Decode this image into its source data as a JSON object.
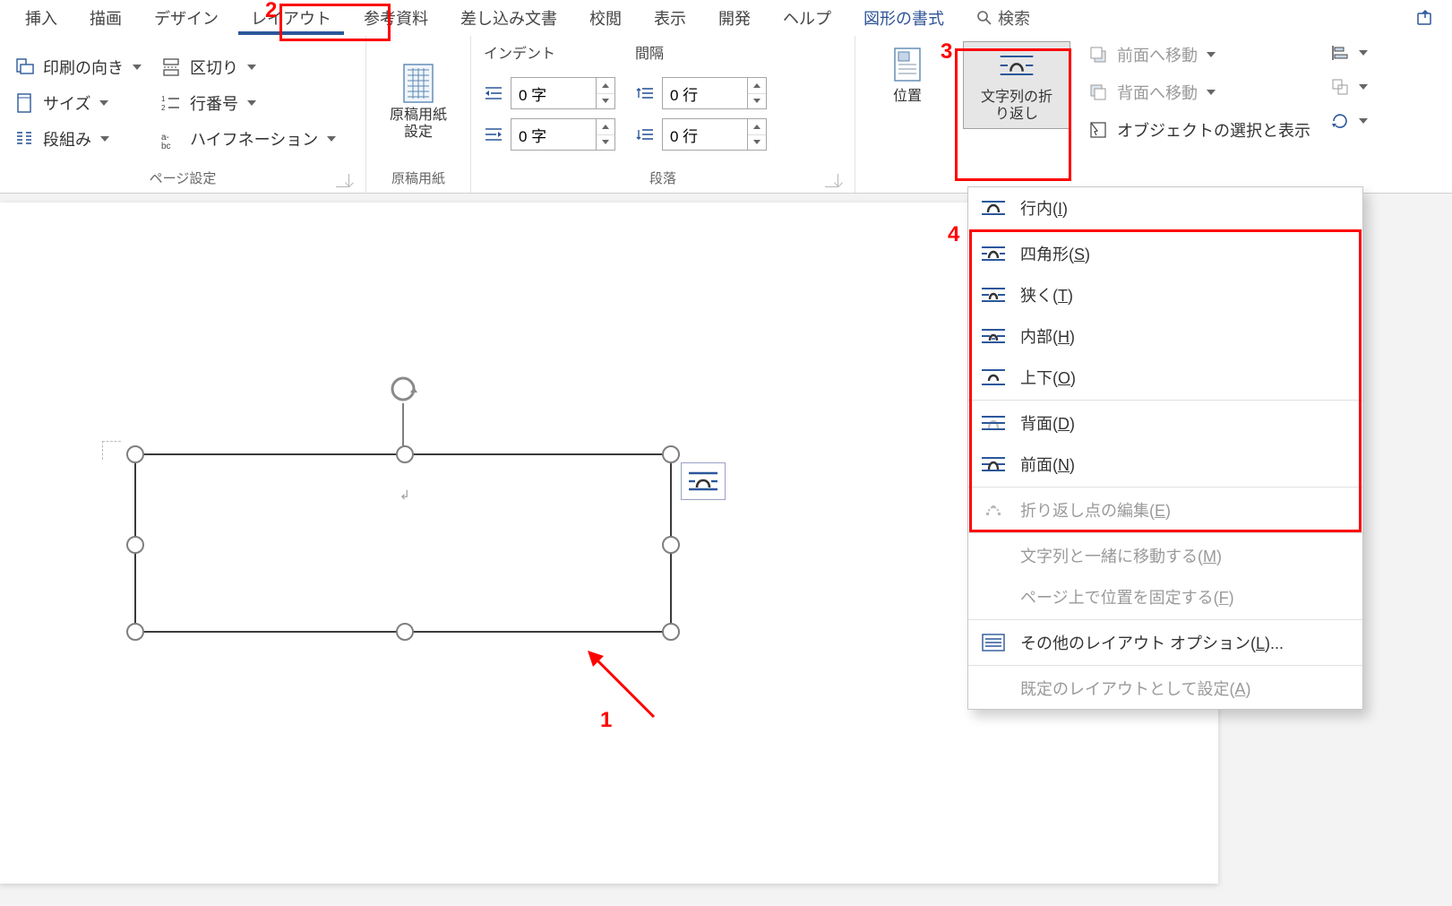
{
  "tabs": {
    "insert": "挿入",
    "draw": "描画",
    "design": "デザイン",
    "layout": "レイアウト",
    "references": "参考資料",
    "mailings": "差し込み文書",
    "review": "校閲",
    "view": "表示",
    "developer": "開発",
    "help": "ヘルプ",
    "shape_format": "図形の書式",
    "search": "検索"
  },
  "page_setup": {
    "orientation": "印刷の向き",
    "size": "サイズ",
    "columns": "段組み",
    "breaks": "区切り",
    "line_numbers": "行番号",
    "hyphenation": "ハイフネーション",
    "group_label": "ページ設定"
  },
  "manuscript": {
    "button": "原稿用紙\n設定",
    "group_label": "原稿用紙"
  },
  "paragraph": {
    "indent_header": "インデント",
    "spacing_header": "間隔",
    "indent_left_value": "0 字",
    "indent_right_value": "0 字",
    "spacing_before_value": "0 行",
    "spacing_after_value": "0 行",
    "group_label": "段落"
  },
  "arrange": {
    "position": "位置",
    "wrap_text": "文字列の折\nり返し",
    "bring_forward": "前面へ移動",
    "send_backward": "背面へ移動",
    "selection_pane": "オブジェクトの選択と表示",
    "align": "配置",
    "group": "グループ化",
    "rotate": "回転"
  },
  "wrap_menu": {
    "inline": "行内",
    "inline_key": "I",
    "square": "四角形",
    "square_key": "S",
    "tight": "狭く",
    "tight_key": "T",
    "through": "内部",
    "through_key": "H",
    "top_bottom": "上下",
    "top_bottom_key": "O",
    "behind": "背面",
    "behind_key": "D",
    "front": "前面",
    "front_key": "N",
    "edit_points": "折り返し点の編集",
    "edit_points_key": "E",
    "move_with_text": "文字列と一緒に移動する",
    "move_with_text_key": "M",
    "fix_on_page": "ページ上で位置を固定する",
    "fix_on_page_key": "F",
    "more_options": "その他のレイアウト オプション",
    "more_options_key": "L",
    "set_default": "既定のレイアウトとして設定",
    "set_default_key": "A"
  },
  "annotations": {
    "n1": "1",
    "n2": "2",
    "n3": "3",
    "n4": "4"
  }
}
